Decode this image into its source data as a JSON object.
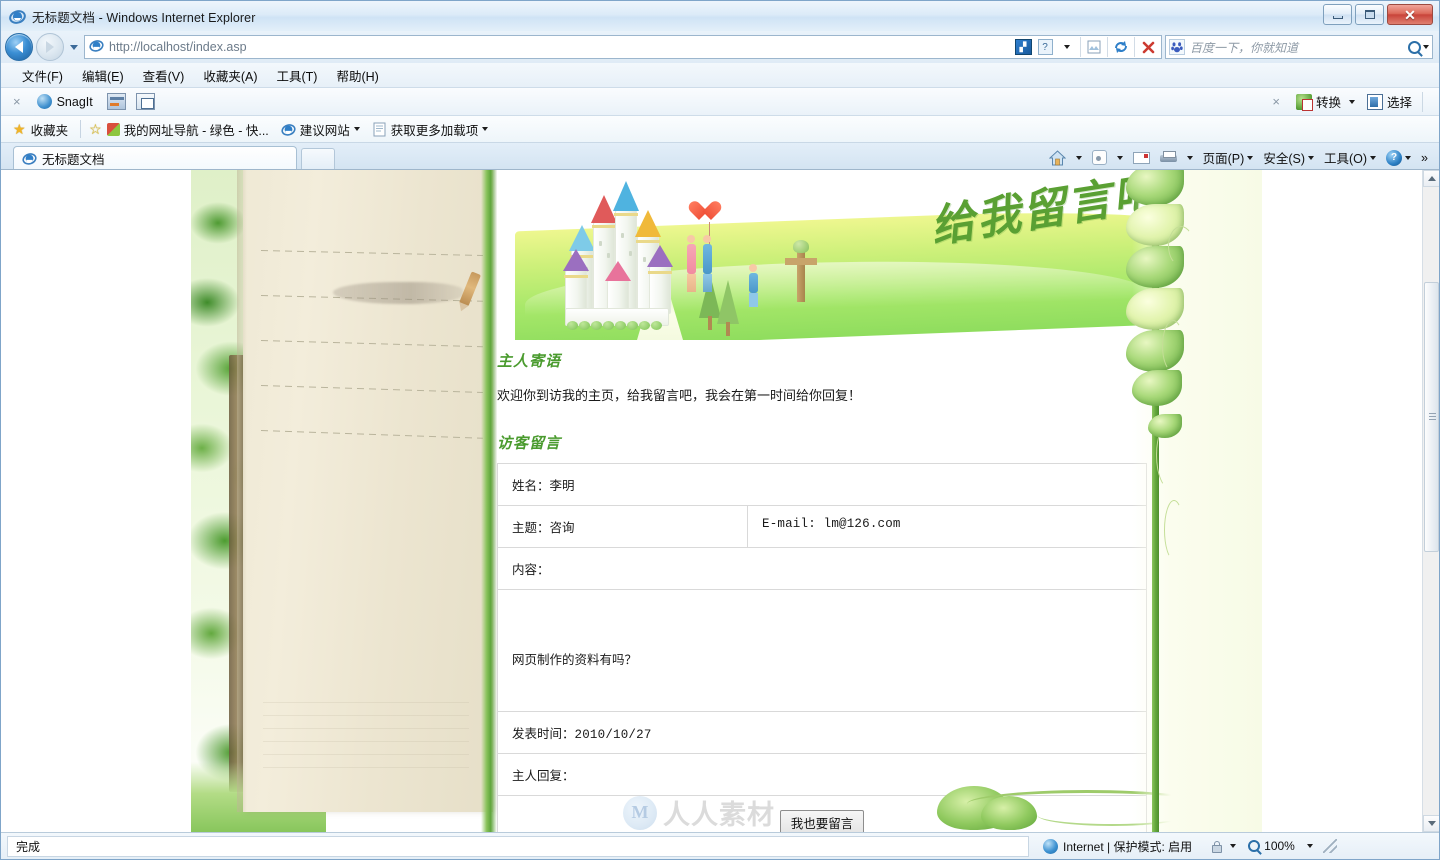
{
  "window": {
    "title": "无标题文档 - Windows Internet Explorer",
    "minimize_label": "最小化",
    "maximize_label": "最大化",
    "close_label": "关闭"
  },
  "address_bar": {
    "url": "http://localhost/index.asp",
    "back_label": "后退",
    "forward_label": "前进",
    "history_label": "最近访问的页面",
    "compatibility_label": "兼容性视图",
    "refresh_label": "刷新",
    "stop_label": "停止"
  },
  "search": {
    "placeholder": "百度一下，你就知道",
    "provider_icon": "baidu-icon",
    "go_label": "搜索"
  },
  "menubar": {
    "items": [
      {
        "label": "文件(F)"
      },
      {
        "label": "编辑(E)"
      },
      {
        "label": "查看(V)"
      },
      {
        "label": "收藏夹(A)"
      },
      {
        "label": "工具(T)"
      },
      {
        "label": "帮助(H)"
      }
    ]
  },
  "snagit_toolbar": {
    "close_label": "×",
    "brand": "SnagIt",
    "right_close_label": "×",
    "convert_label": "转换",
    "select_label": "选择"
  },
  "favorites_bar": {
    "favorites_label": "收藏夹",
    "links": [
      {
        "label": "我的网址导航 - 绿色 - 快...",
        "icon": "windows-flag-icon"
      },
      {
        "label": "建议网站",
        "icon": "ie-icon",
        "has_dropdown": true
      },
      {
        "label": "获取更多加载项",
        "icon": "page-icon",
        "has_dropdown": true
      }
    ]
  },
  "tabs": {
    "items": [
      {
        "label": "无标题文档",
        "icon": "ie-icon",
        "active": true
      }
    ],
    "new_tab_label": "新选项卡"
  },
  "command_bar": {
    "home_label": "主页",
    "feeds_label": "源",
    "mail_label": "读取邮件",
    "print_label": "打印",
    "page_label": "页面(P)",
    "safety_label": "安全(S)",
    "tools_label": "工具(O)",
    "help_label": "帮助",
    "overflow_label": "»"
  },
  "page": {
    "banner": {
      "calligraphy": "给我留言吧!",
      "art": [
        "castle-illustration",
        "couple-with-heart-balloon",
        "child-illustration",
        "conifer-trees",
        "signpost"
      ]
    },
    "owner_message": {
      "heading": "主人寄语",
      "text": "欢迎你到访我的主页，给我留言吧，我会在第一时间给你回复！"
    },
    "guestbook": {
      "heading": "访客留言",
      "entries": [
        {
          "name_label": "姓名：",
          "name_value": "李明",
          "subject_label": "主题：",
          "subject_value": "咨询",
          "email_label": "E-mail:",
          "email_value": "lm@126.com",
          "content_label": "内容：",
          "content_value": "网页制作的资料有吗？",
          "time_label": "发表时间：",
          "time_value": "2010/10/27",
          "reply_label": "主人回复："
        }
      ],
      "submit_button": "我也要留言"
    },
    "watermark": {
      "logo_text": "M",
      "text": "人人素材"
    }
  },
  "status_bar": {
    "status": "完成",
    "zone": "Internet | 保护模式: 启用",
    "zoom": "100%"
  },
  "colors": {
    "heading_green": "#4a9b2e",
    "calligraphy_green": "#5aa033",
    "leaf_green": "#5fa83a",
    "accent_blue": "#2b6fa8"
  }
}
